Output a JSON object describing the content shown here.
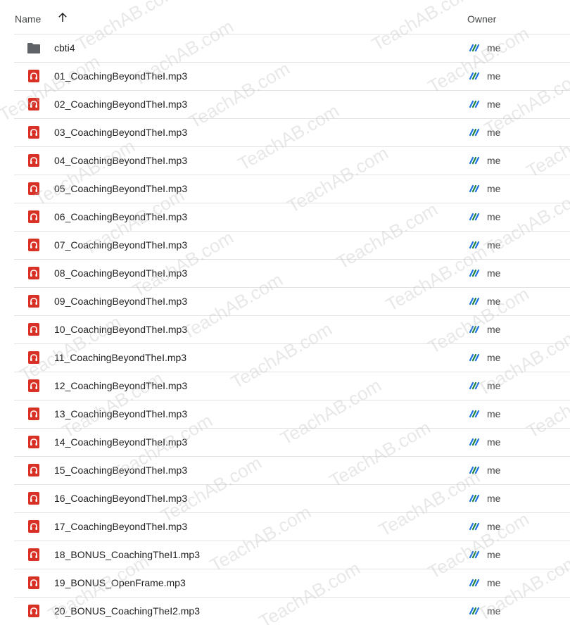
{
  "header": {
    "name_label": "Name",
    "sort_icon": "arrow-up-icon",
    "owner_label": "Owner"
  },
  "rows": [
    {
      "name": "cbti4",
      "type": "folder",
      "owner": "me"
    },
    {
      "name": "01_CoachingBeyondTheI.mp3",
      "type": "audio",
      "owner": "me"
    },
    {
      "name": "02_CoachingBeyondTheI.mp3",
      "type": "audio",
      "owner": "me"
    },
    {
      "name": "03_CoachingBeyondTheI.mp3",
      "type": "audio",
      "owner": "me"
    },
    {
      "name": "04_CoachingBeyondTheI.mp3",
      "type": "audio",
      "owner": "me"
    },
    {
      "name": "05_CoachingBeyondTheI.mp3",
      "type": "audio",
      "owner": "me"
    },
    {
      "name": "06_CoachingBeyondTheI.mp3",
      "type": "audio",
      "owner": "me"
    },
    {
      "name": "07_CoachingBeyondTheI.mp3",
      "type": "audio",
      "owner": "me"
    },
    {
      "name": "08_CoachingBeyondTheI.mp3",
      "type": "audio",
      "owner": "me"
    },
    {
      "name": "09_CoachingBeyondTheI.mp3",
      "type": "audio",
      "owner": "me"
    },
    {
      "name": "10_CoachingBeyondTheI.mp3",
      "type": "audio",
      "owner": "me"
    },
    {
      "name": "11_CoachingBeyondTheI.mp3",
      "type": "audio",
      "owner": "me"
    },
    {
      "name": "12_CoachingBeyondTheI.mp3",
      "type": "audio",
      "owner": "me"
    },
    {
      "name": "13_CoachingBeyondTheI.mp3",
      "type": "audio",
      "owner": "me"
    },
    {
      "name": "14_CoachingBeyondTheI.mp3",
      "type": "audio",
      "owner": "me"
    },
    {
      "name": "15_CoachingBeyondTheI.mp3",
      "type": "audio",
      "owner": "me"
    },
    {
      "name": "16_CoachingBeyondTheI.mp3",
      "type": "audio",
      "owner": "me"
    },
    {
      "name": "17_CoachingBeyondTheI.mp3",
      "type": "audio",
      "owner": "me"
    },
    {
      "name": "18_BONUS_CoachingTheI1.mp3",
      "type": "audio",
      "owner": "me"
    },
    {
      "name": "19_BONUS_OpenFrame.mp3",
      "type": "audio",
      "owner": "me"
    },
    {
      "name": "20_BONUS_CoachingTheI2.mp3",
      "type": "audio",
      "owner": "me"
    }
  ],
  "watermark": "TeachAB.com",
  "colors": {
    "audio_icon": "#d93025",
    "folder_icon": "#5f6368",
    "owner_icon_blue": "#1a73e8",
    "owner_icon_green": "#188038",
    "divider": "#e1e3e1"
  }
}
